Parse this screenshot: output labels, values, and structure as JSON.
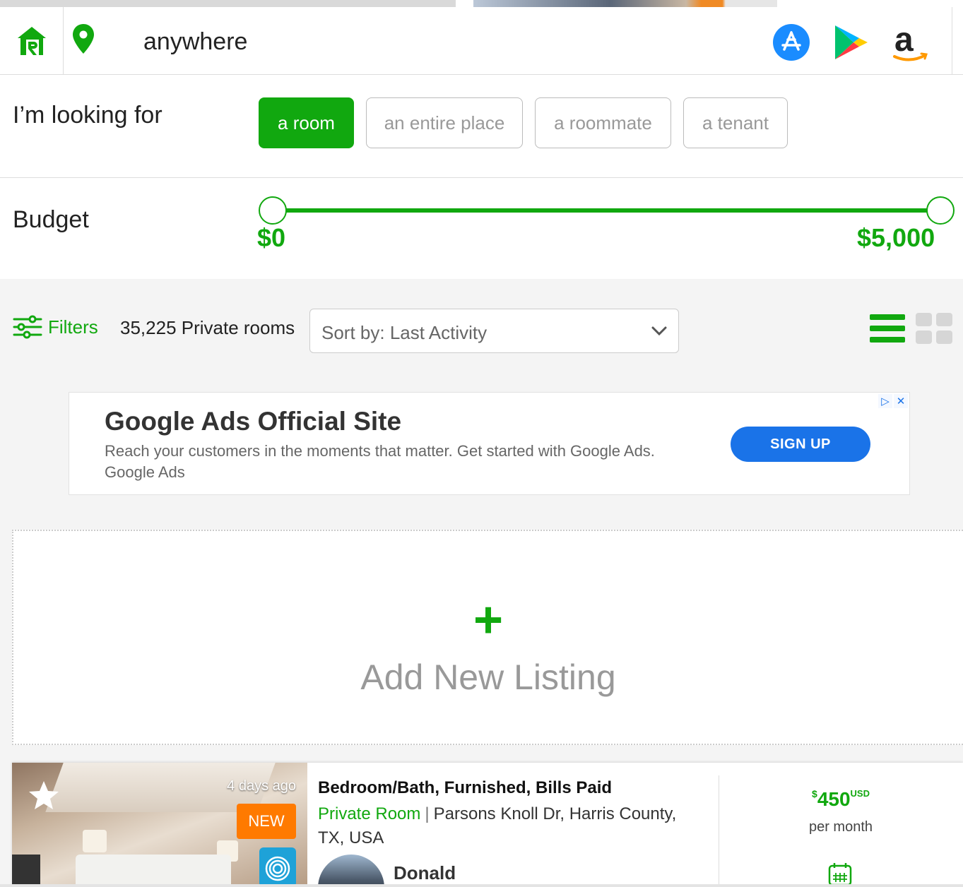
{
  "header": {
    "location": "anywhere",
    "stores": [
      "app-store-icon",
      "google-play-icon",
      "amazon-icon"
    ]
  },
  "search_type": {
    "label": "I’m looking for",
    "options": [
      "a room",
      "an entire place",
      "a roommate",
      "a tenant"
    ],
    "selected": "a room"
  },
  "budget": {
    "label": "Budget",
    "min_label": "$0",
    "max_label": "$5,000",
    "min_value": 0,
    "max_value": 5000
  },
  "toolbar": {
    "filters_label": "Filters",
    "result_count": "35,225 Private rooms",
    "sort_label": "Sort by: Last Activity"
  },
  "ad": {
    "title": "Google Ads Official Site",
    "description": "Reach your customers in the moments that matter. Get started with Google Ads.",
    "brand": "Google Ads",
    "cta": "SIGN UP"
  },
  "add_listing": {
    "plus": "+",
    "label": "Add New Listing"
  },
  "listing": {
    "posted": "4 days ago",
    "badge": "NEW",
    "title": "Bedroom/Bath, Furnished, Bills Paid",
    "room_type": "Private Room",
    "separator": "|",
    "location": "Parsons Knoll Dr, Harris County, TX, USA",
    "owner": "Donald",
    "price_currency_symbol": "$",
    "price": "450",
    "price_unit": "USD",
    "price_period": "per month"
  },
  "colors": {
    "brand_green": "#11a80f",
    "ad_blue": "#1a73e8",
    "badge_orange": "#ff7a00"
  }
}
